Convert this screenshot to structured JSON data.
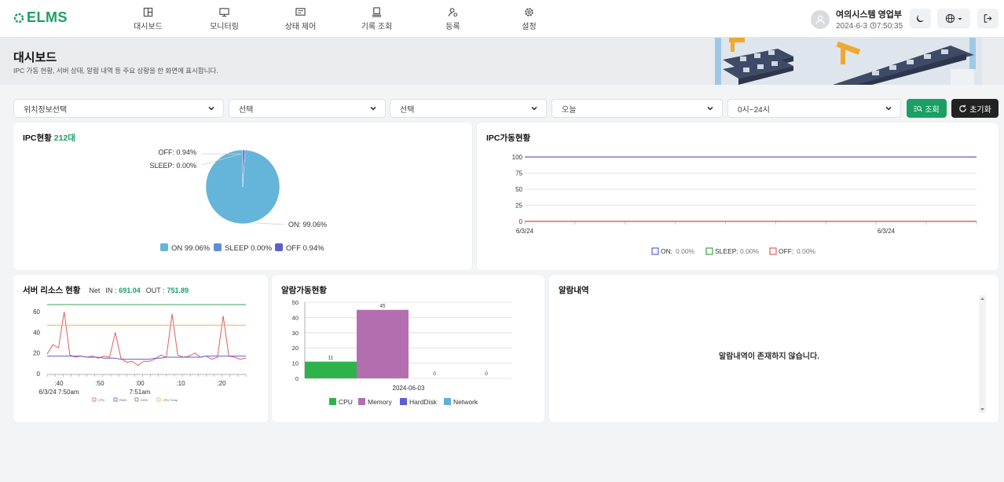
{
  "header": {
    "logo_text": "ELMS",
    "nav": [
      {
        "label": "대시보드",
        "icon": "dashboard-icon"
      },
      {
        "label": "모니터링",
        "icon": "monitor-icon"
      },
      {
        "label": "상태 제어",
        "icon": "status-control-icon"
      },
      {
        "label": "기록 조회",
        "icon": "history-icon"
      },
      {
        "label": "등록",
        "icon": "user-register-icon"
      },
      {
        "label": "설정",
        "icon": "gear-icon"
      }
    ],
    "user_name": "여의시스템 영업부",
    "date": "2024-6-3",
    "time": "7:50:35"
  },
  "banner": {
    "title": "대시보드",
    "description": "IPC 가동 현황, 서버 상태, 알람 내역 등 주요 상황을 한 화면에 표시합니다."
  },
  "filters": {
    "location": "위치정보선택",
    "select1": "선택",
    "select2": "선택",
    "day": "오늘",
    "hours": "0시~24시",
    "search_label": "조회",
    "reset_label": "초기화"
  },
  "ipc_status": {
    "title": "IPC현황",
    "count": "212대",
    "labels": {
      "off": "OFF: 0.94%",
      "sleep": "SLEEP: 0.00%",
      "on": "ON: 99.06%"
    },
    "legend": [
      "ON 99.06%",
      "SLEEP 0.00%",
      "OFF 0.94%"
    ]
  },
  "ipc_operation": {
    "title": "IPC가동현황",
    "legend": [
      {
        "name": "ON:",
        "value": "0.00%"
      },
      {
        "name": "SLEEP:",
        "value": "0.00%"
      },
      {
        "name": "OFF:",
        "value": "0.00%"
      }
    ]
  },
  "server": {
    "title": "서버 리소스 현황",
    "net_label": "Net",
    "in_label": "IN :",
    "in_value": "691.04",
    "out_label": "OUT :",
    "out_value": "751.89",
    "x_ticks": [
      ":40",
      ":50",
      ":00",
      ":10",
      ":20"
    ],
    "x_sub": [
      "6/3/24 7:50am",
      "7:51am"
    ]
  },
  "alarm_operation": {
    "title": "알람가동현황"
  },
  "alarm_history": {
    "title": "알람내역",
    "empty_text": "알람내역이 존재하지 않습니다."
  },
  "colors": {
    "brand": "#1aa064",
    "on": "#64b5d9",
    "sleep": "#5f8fd8",
    "off": "#5b5fd4",
    "dark_button": "#222222"
  },
  "chart_data": [
    {
      "type": "pie",
      "title": "IPC현황",
      "categories": [
        "ON",
        "SLEEP",
        "OFF"
      ],
      "values": [
        99.06,
        0.0,
        0.94
      ]
    },
    {
      "type": "line",
      "title": "IPC가동현황",
      "x": [
        "6/3/24",
        "6/3/24"
      ],
      "yticks": [
        0,
        25,
        50,
        75,
        100
      ],
      "ylim": [
        0,
        100
      ],
      "series": [
        {
          "name": "ON",
          "values": [
            100,
            100
          ],
          "color": "#5b5fd4"
        },
        {
          "name": "SLEEP",
          "values": [
            0,
            0
          ],
          "color": "#3aa64a"
        },
        {
          "name": "OFF",
          "values": [
            0,
            0
          ],
          "color": "#e35d5d"
        }
      ],
      "grid": true,
      "legend": "bottom"
    },
    {
      "type": "line",
      "title": "서버 리소스 현황",
      "yticks": [
        0,
        20,
        40,
        60
      ],
      "ylim": [
        0,
        70
      ],
      "series": [
        {
          "name": "CPU",
          "color": "#e35d5d",
          "values": [
            19,
            28,
            25,
            60,
            18,
            16,
            17,
            16,
            17,
            15,
            17,
            16,
            40,
            15,
            11,
            12,
            8,
            12,
            12,
            14,
            18,
            16,
            58,
            18,
            16,
            17,
            20,
            16,
            17,
            14,
            16,
            56,
            17,
            16,
            14,
            15
          ]
        },
        {
          "name": "RAM",
          "color": "#5b5fd4",
          "values": [
            17,
            17,
            17,
            17,
            17,
            17,
            17,
            16,
            16,
            16,
            15,
            15,
            15,
            14,
            14,
            14,
            14,
            14,
            14,
            15,
            15,
            16,
            16,
            16,
            16,
            16,
            16,
            16,
            17,
            17,
            17,
            17,
            17,
            17,
            17,
            17
          ]
        },
        {
          "name": "DISK",
          "color": "#3aa64a",
          "values": [
            67,
            67
          ]
        },
        {
          "name": "CPU Temp",
          "color": "#f5b04a",
          "values": [
            47,
            47
          ]
        }
      ],
      "legend": "bottom"
    },
    {
      "type": "bar",
      "title": "알람가동현황",
      "categories": [
        "2024-06-03"
      ],
      "series": [
        {
          "name": "CPU",
          "values": [
            11
          ],
          "color": "#2fb24c"
        },
        {
          "name": "Memory",
          "values": [
            45
          ],
          "color": "#b36eaf"
        },
        {
          "name": "HardDisk",
          "values": [
            0
          ],
          "color": "#5b5fd4"
        },
        {
          "name": "Network",
          "values": [
            0
          ],
          "color": "#5fb0d9"
        }
      ],
      "yticks": [
        0,
        10,
        20,
        30,
        40,
        50
      ],
      "ylim": [
        0,
        50
      ],
      "grid": true,
      "legend": "bottom"
    }
  ]
}
